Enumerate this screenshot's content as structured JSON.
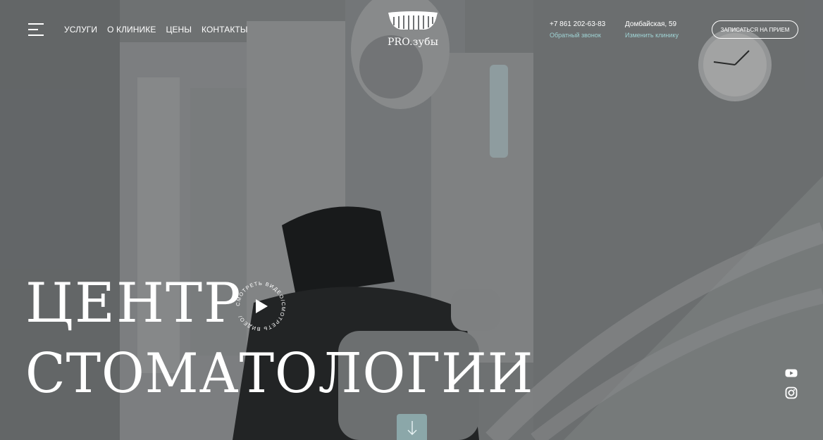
{
  "nav": {
    "items": [
      "УСЛУГИ",
      "О КЛИНИКЕ",
      "ЦЕНЫ",
      "КОНТАКТЫ"
    ]
  },
  "logo": {
    "text": "PRO.зубы"
  },
  "phone": {
    "number": "+7 861 202-63-83",
    "action": "Обратный звонок"
  },
  "address": {
    "text": "Домбайская, 59",
    "action": "Изменить клинику"
  },
  "cta": {
    "label": "ЗАПИСАТЬСЯ НА ПРИЕМ"
  },
  "hero": {
    "line1": "ЦЕНТР",
    "line2": "СТОМАТОЛОГИИ",
    "video_label": "СМОТРЕТЬ ВИДЕО/СМОТРЕТЬ ВИДЕО/"
  },
  "icons": {
    "menu": "menu-icon",
    "play": "play-icon",
    "youtube": "youtube-icon",
    "instagram": "instagram-icon",
    "scroll": "arrow-down-icon"
  },
  "colors": {
    "accent": "#9fd3d4",
    "scroll_button": "#96b9bc"
  }
}
